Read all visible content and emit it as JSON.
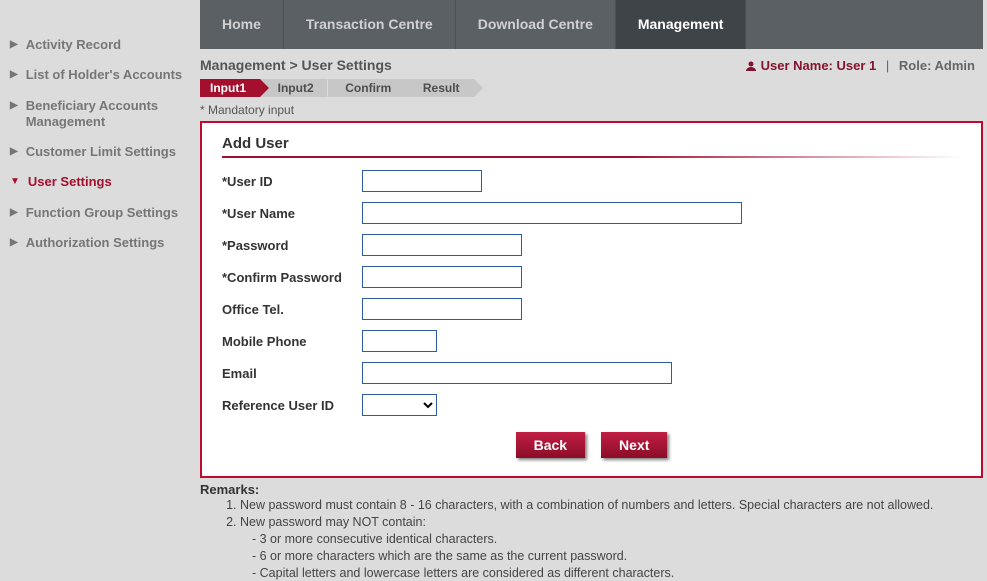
{
  "sidebar": {
    "items": [
      {
        "label": "Activity Record"
      },
      {
        "label": "List of Holder's Accounts"
      },
      {
        "label": "Beneficiary Accounts Management"
      },
      {
        "label": "Customer Limit Settings"
      },
      {
        "label": "User Settings"
      },
      {
        "label": "Function Group Settings"
      },
      {
        "label": "Authorization Settings"
      }
    ]
  },
  "topnav": {
    "tabs": [
      {
        "label": "Home"
      },
      {
        "label": "Transaction Centre"
      },
      {
        "label": "Download Centre"
      },
      {
        "label": "Management"
      }
    ]
  },
  "breadcrumb": {
    "parent": "Management",
    "sep": " > ",
    "child": "User Settings"
  },
  "userbox": {
    "username_label": "User Name:",
    "username_value": "User 1",
    "role_label": "Role:",
    "role_value": "Admin"
  },
  "steps": {
    "items": [
      {
        "label": "Input1"
      },
      {
        "label": "Input2"
      },
      {
        "label": "Confirm"
      },
      {
        "label": "Result"
      }
    ]
  },
  "mandatory_note": "* Mandatory input",
  "card": {
    "title": "Add User",
    "fields": {
      "user_id": {
        "label": "*User ID"
      },
      "user_name": {
        "label": "*User Name"
      },
      "password": {
        "label": "*Password"
      },
      "confirm_password": {
        "label": "*Confirm Password"
      },
      "office_tel": {
        "label": "Office Tel."
      },
      "mobile_phone": {
        "label": "Mobile Phone"
      },
      "email": {
        "label": "Email"
      },
      "reference_user_id": {
        "label": "Reference User ID",
        "selected": ""
      }
    },
    "buttons": {
      "back": "Back",
      "next": "Next"
    }
  },
  "remarks": {
    "title": "Remarks:",
    "item1": "New password must contain 8 - 16 characters, with a combination of numbers and letters. Special characters are not allowed.",
    "item2": "New password may NOT contain:",
    "item2_sub": [
      "- 3 or more consecutive identical characters.",
      "- 6 or more characters which are the same as the current password.",
      "- Capital letters and lowercase letters are considered as different characters."
    ]
  }
}
